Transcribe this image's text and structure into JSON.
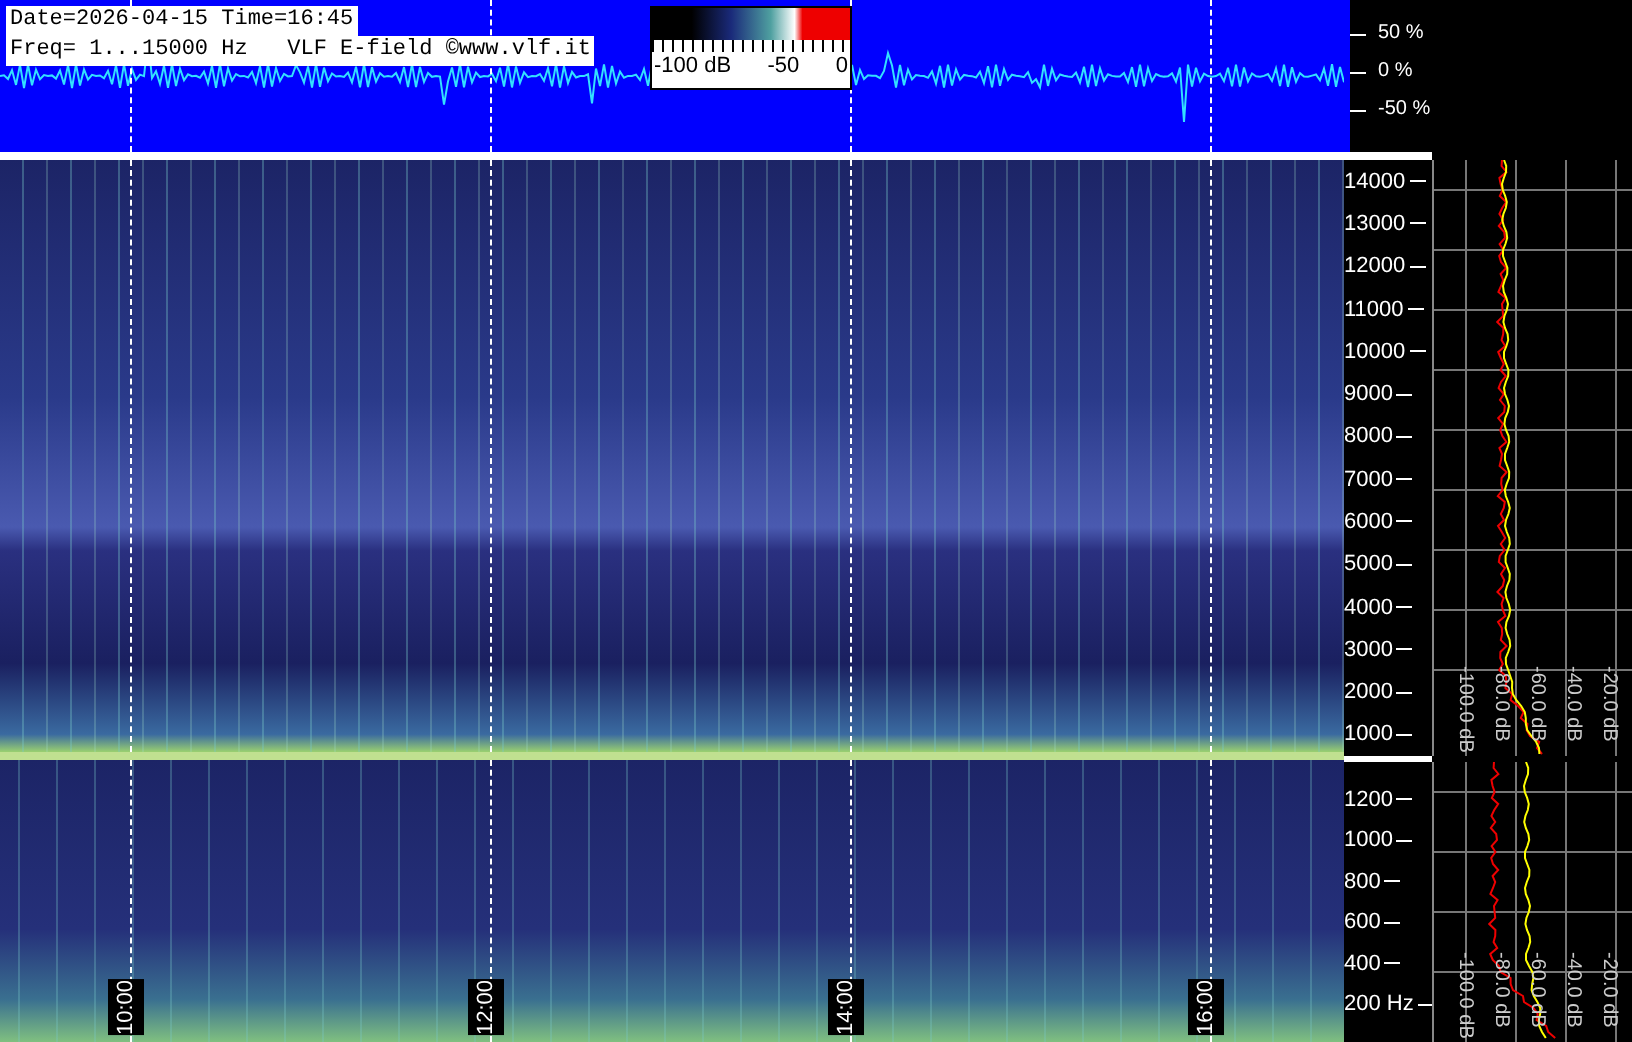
{
  "header": {
    "date_time": "Date=2026-04-15 Time=16:45",
    "info": "Freq= 1...15000 Hz   VLF E-field ©www.vlf.it"
  },
  "color_scale": {
    "labels": [
      "-100 dB",
      "-50",
      "0"
    ]
  },
  "amplitude_labels": [
    "50 %",
    "0 %",
    "-50 %"
  ],
  "upper_spectrum": {
    "freq_labels": [
      "14000",
      "13000",
      "12000",
      "11000",
      "10000",
      "9000",
      "8000",
      "7000",
      "6000",
      "5000",
      "4000",
      "3000",
      "2000",
      "1000"
    ],
    "db_labels": [
      "-100.0 dB",
      "-80.0 dB",
      "-60.0 dB",
      "-40.0 dB",
      "-20.0 dB"
    ]
  },
  "lower_spectrum": {
    "freq_labels": [
      "1200",
      "1000",
      "800",
      "600",
      "400",
      "200 Hz"
    ],
    "db_labels": [
      "-100.0 dB",
      "-80.0 dB",
      "-60.0 dB",
      "-40.0 dB",
      "-20.0 dB"
    ]
  },
  "time_labels": [
    "10:00",
    "12:00",
    "14:00",
    "16:00"
  ]
}
